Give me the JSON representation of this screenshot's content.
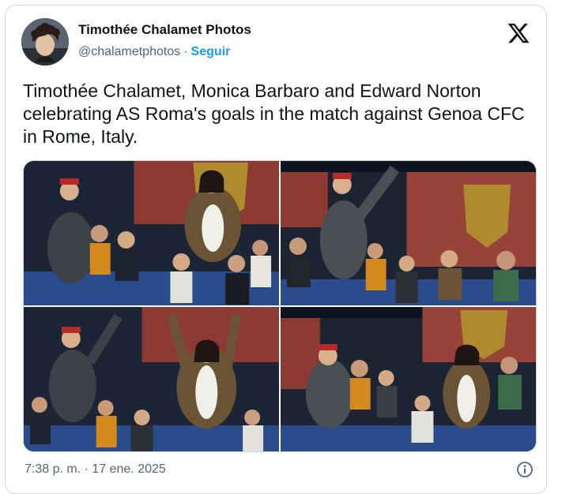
{
  "tweet": {
    "author": {
      "display_name": "Timothée Chalamet Photos",
      "handle": "@chalametphotos",
      "separator": "·",
      "follow_label": "Seguir",
      "avatar_icon": "profile-avatar"
    },
    "platform_icon": "x-logo-icon",
    "text": "Timothée Chalamet, Monica Barbaro and Edward Norton celebrating AS Roma's goals in the match against Genoa CFC in Rome, Italy.",
    "media": [
      {
        "icon": "photo-stadium-celebration-1"
      },
      {
        "icon": "photo-stadium-celebration-2"
      },
      {
        "icon": "photo-stadium-celebration-3"
      },
      {
        "icon": "photo-stadium-celebration-4"
      }
    ],
    "timestamp": "7:38 p. m. · 17 ene. 2025",
    "info_icon": "info-icon"
  },
  "colors": {
    "accent": "#1d9bf0",
    "text_primary": "#0f1419",
    "text_secondary": "#536471",
    "border": "#cfd9de"
  }
}
